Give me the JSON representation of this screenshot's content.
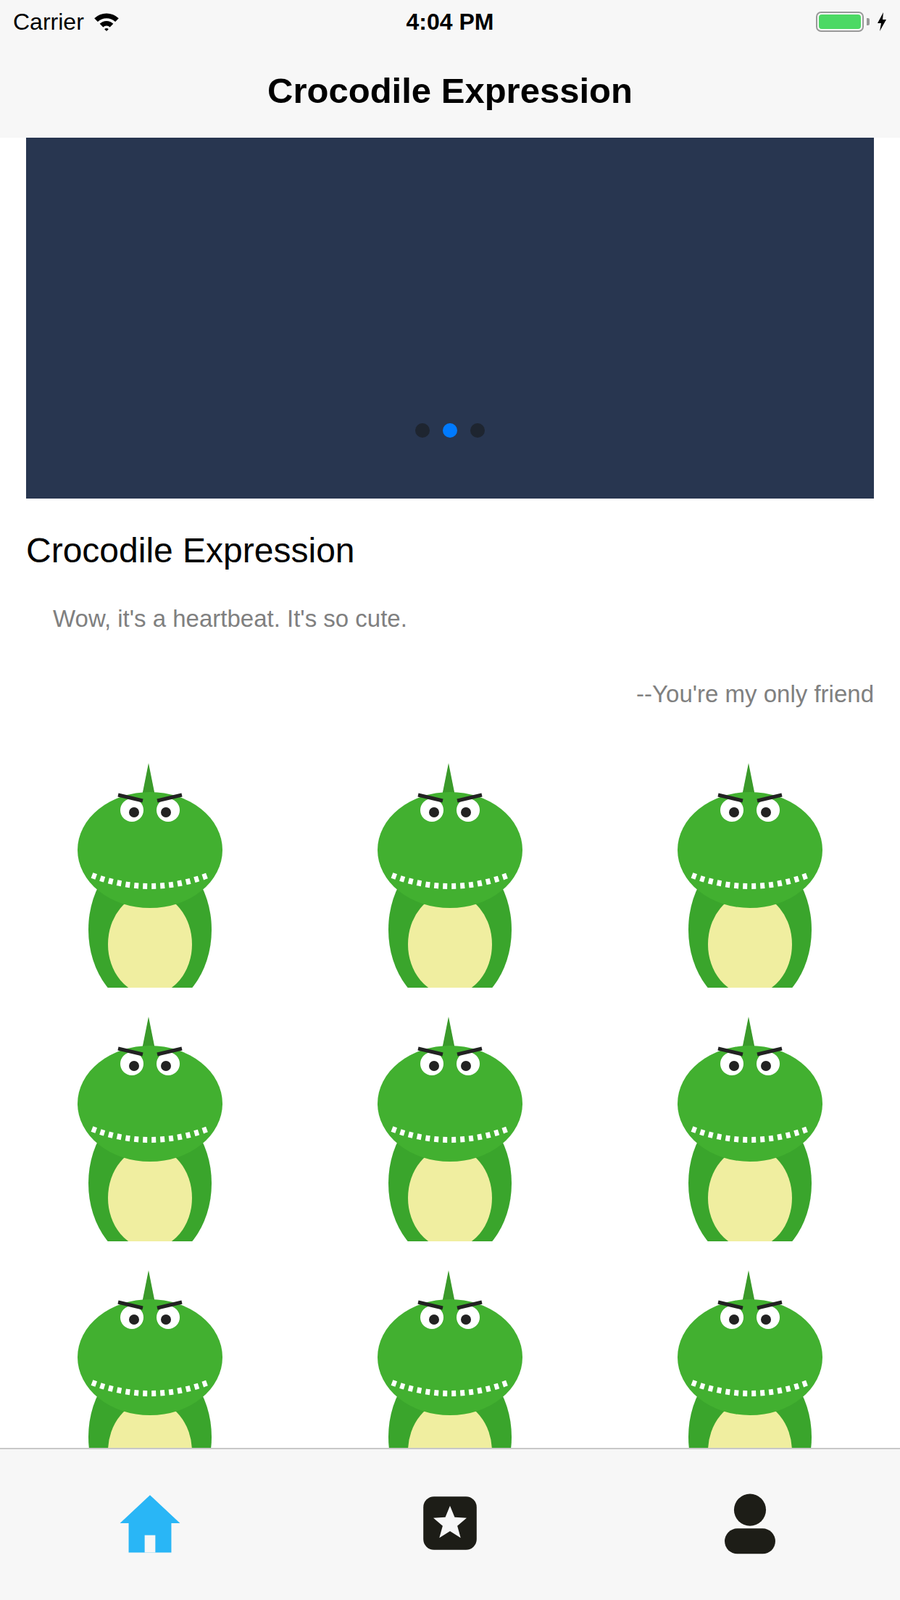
{
  "status_bar": {
    "carrier": "Carrier",
    "time": "4:04 PM",
    "battery": {
      "level": 1,
      "charging": true
    }
  },
  "nav_bar": {
    "title": "Crocodile Expression"
  },
  "banner": {
    "pager": [
      {
        "selected": false
      },
      {
        "selected": true
      },
      {
        "selected": false
      }
    ]
  },
  "article": {
    "title": "Crocodile Expression",
    "quote": "Wow, it's a heartbeat. It's so cute.",
    "author": "--You're my only friend"
  },
  "tab_bar": {
    "tabs": [
      {
        "kind": "home",
        "selected": true
      },
      {
        "kind": "star",
        "selected": false
      },
      {
        "kind": "profile",
        "selected": false
      }
    ]
  }
}
